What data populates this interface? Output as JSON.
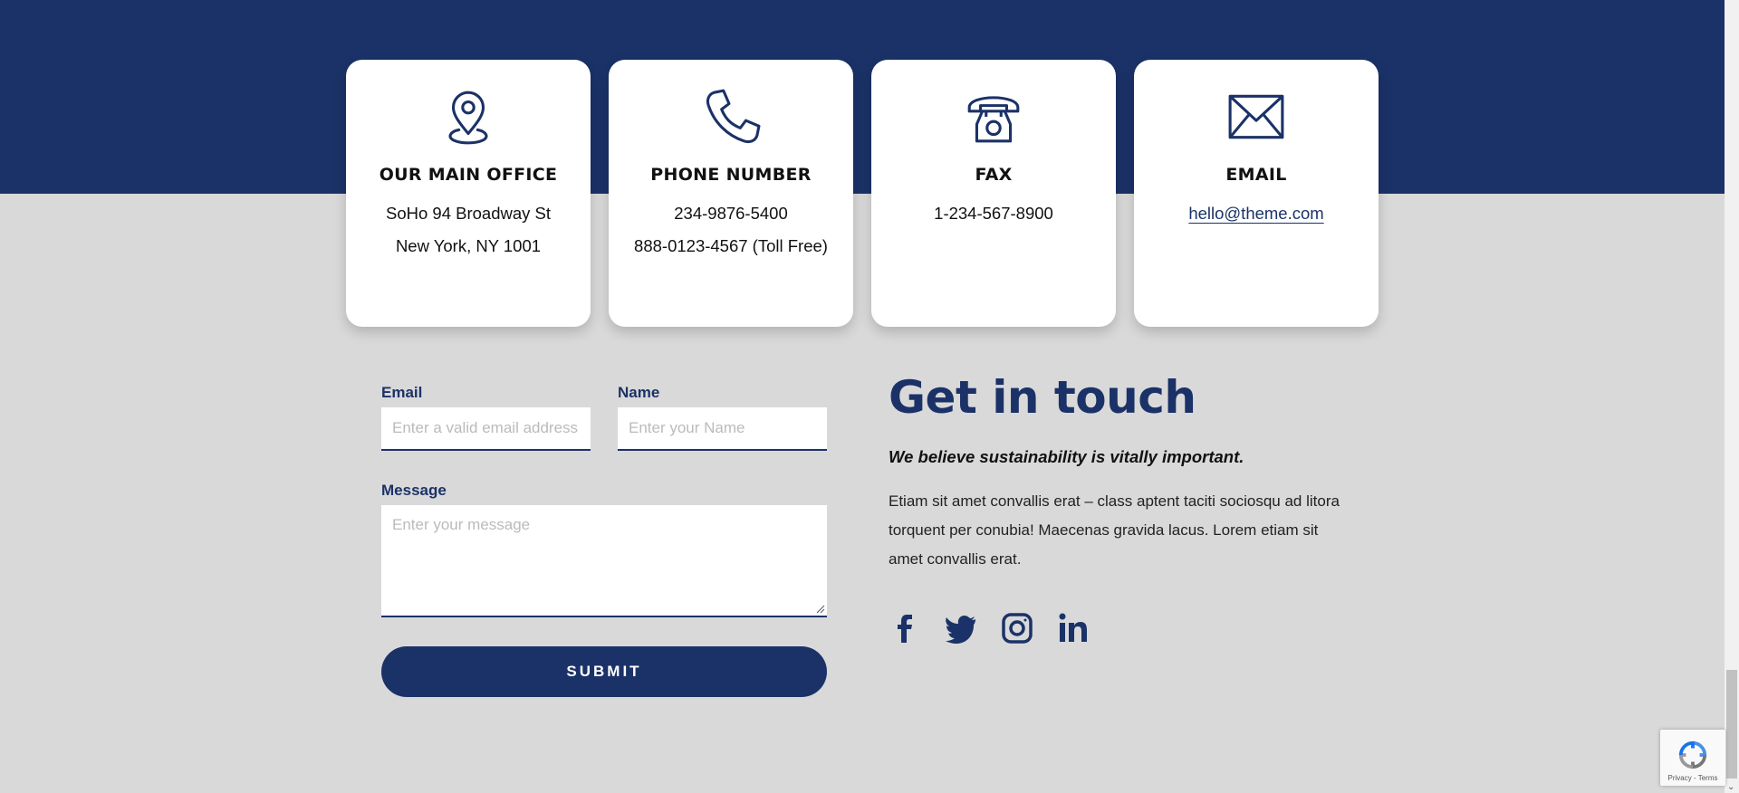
{
  "cards": [
    {
      "title": "OUR MAIN OFFICE",
      "lines": [
        "SoHo 94 Broadway St",
        "New York, NY 1001"
      ],
      "icon": "location-pin-icon"
    },
    {
      "title": "PHONE NUMBER",
      "lines": [
        "234-9876-5400",
        "888-0123-4567 (Toll Free)"
      ],
      "icon": "phone-icon"
    },
    {
      "title": "FAX",
      "lines": [
        "1-234-567-8900"
      ],
      "icon": "telephone-icon"
    },
    {
      "title": "EMAIL",
      "link": "hello@theme.com",
      "icon": "envelope-icon"
    }
  ],
  "form": {
    "email_label": "Email",
    "email_placeholder": "Enter a valid email address",
    "name_label": "Name",
    "name_placeholder": "Enter your Name",
    "message_label": "Message",
    "message_placeholder": "Enter your message",
    "submit_label": "SUBMIT"
  },
  "info": {
    "heading": "Get in touch",
    "tagline": "We believe sustainability is vitally important.",
    "body": "Etiam sit amet convallis erat – class aptent taciti sociosqu ad litora torquent per conubia! Maecenas gravida lacus. Lorem etiam sit amet convallis erat.",
    "social": [
      "facebook-icon",
      "twitter-icon",
      "instagram-icon",
      "linkedin-icon"
    ]
  },
  "recaptcha": {
    "text": "Privacy - Terms"
  },
  "colors": {
    "brand": "#1b3268",
    "background": "#d9d9d9"
  }
}
